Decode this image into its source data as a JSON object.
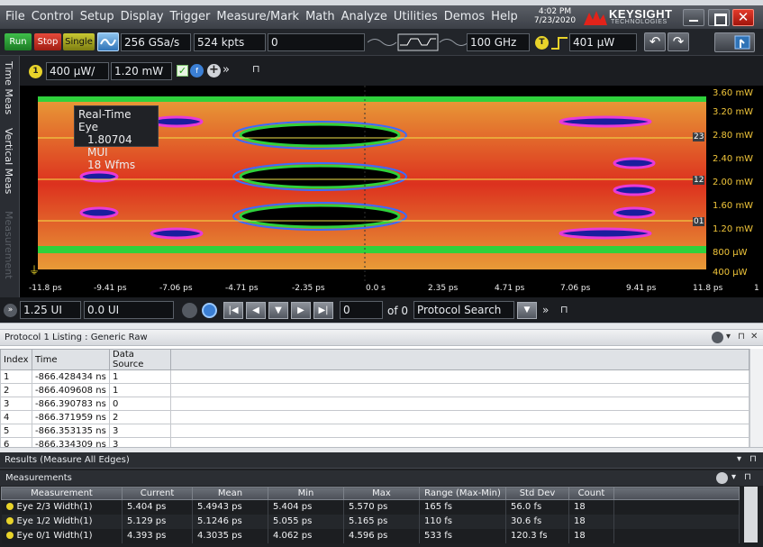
{
  "topstrip_text": "",
  "menu": [
    "File",
    "Control",
    "Setup",
    "Display",
    "Trigger",
    "Measure/Mark",
    "Math",
    "Analyze",
    "Utilities",
    "Demos",
    "Help"
  ],
  "clock": {
    "time": "4:02 PM",
    "date": "7/23/2020"
  },
  "brand": {
    "name": "KEYSIGHT",
    "tagline": "TECHNOLOGIES",
    "accent": "#e2231a"
  },
  "controls": {
    "run": "Run",
    "stop": "Stop",
    "single": "Single",
    "sample_rate": "256 GSa/s",
    "memory_depth": "524 kpts",
    "delay": "0",
    "bandwidth": "100 GHz",
    "trigger_channel": "T",
    "trigger_level": "401 µW"
  },
  "left_tabs": [
    "Time Meas",
    "Vertical Meas",
    "Measurement"
  ],
  "channel": {
    "number": "1",
    "scale": "400 µW/",
    "offset": "1.20 mW",
    "color": "#e8d32a"
  },
  "eye_info": {
    "title": "Real-Time Eye",
    "ui_count": "1.80704 MUI",
    "waveforms": "18 Wfms"
  },
  "eye_markers": [
    "23",
    "12",
    "01"
  ],
  "y_axis_labels": [
    "3.60 mW",
    "3.20 mW",
    "2.80 mW",
    "2.40 mW",
    "2.00 mW",
    "1.60 mW",
    "1.20 mW",
    "800 µW",
    "400 µW"
  ],
  "x_axis_labels": [
    "-11.8 ps",
    "-9.41 ps",
    "-7.06 ps",
    "-4.71 ps",
    "-2.35 ps",
    "0.0 s",
    "2.35 ps",
    "4.71 ps",
    "7.06 ps",
    "9.41 ps",
    "11.8 ps"
  ],
  "x_axis_extra": "1",
  "horizontal": {
    "scale": "1.25 UI",
    "position": "0.0 UI"
  },
  "navigation": {
    "index": "0",
    "of_label": "of 0",
    "mode": "Protocol Search"
  },
  "protocol": {
    "title": "Protocol 1 Listing : Generic Raw",
    "columns": [
      "Index",
      "Time",
      "Data Source"
    ],
    "rows": [
      [
        "1",
        "-866.428434 ns",
        "1"
      ],
      [
        "2",
        "-866.409608 ns",
        "1"
      ],
      [
        "3",
        "-866.390783 ns",
        "0"
      ],
      [
        "4",
        "-866.371959 ns",
        "2"
      ],
      [
        "5",
        "-866.353135 ns",
        "3"
      ],
      [
        "6",
        "-866.334309 ns",
        "3"
      ]
    ]
  },
  "results": {
    "title": "Results  (Measure All Edges)",
    "subtitle": "Measurements",
    "columns": [
      "Measurement",
      "Current",
      "Mean",
      "Min",
      "Max",
      "Range (Max-Min)",
      "Std Dev",
      "Count"
    ],
    "rows": [
      [
        "Eye 2/3 Width(1)",
        "5.404 ps",
        "5.4943 ps",
        "5.404 ps",
        "5.570 ps",
        "165 fs",
        "56.0 fs",
        "18"
      ],
      [
        "Eye 1/2 Width(1)",
        "5.129 ps",
        "5.1246 ps",
        "5.055 ps",
        "5.165 ps",
        "110 fs",
        "30.6 fs",
        "18"
      ],
      [
        "Eye 0/1 Width(1)",
        "4.393 ps",
        "4.3035 ps",
        "4.062 ps",
        "4.596 ps",
        "533 fs",
        "120.3 fs",
        "18"
      ]
    ]
  }
}
